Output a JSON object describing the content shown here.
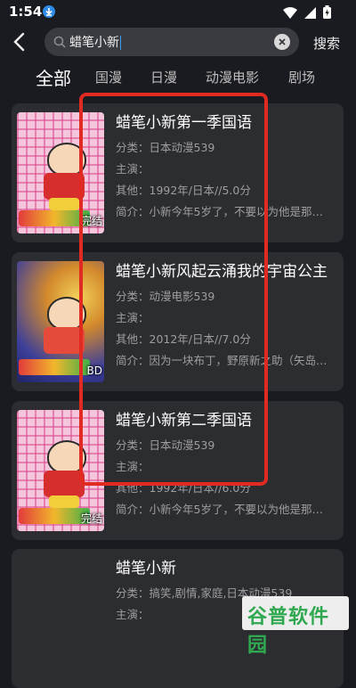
{
  "status_bar": {
    "time": "1:54"
  },
  "search": {
    "query": "蜡笔小新",
    "submit_label": "搜索"
  },
  "tabs": [
    {
      "label": "全部",
      "active": true
    },
    {
      "label": "国漫",
      "active": false
    },
    {
      "label": "日漫",
      "active": false
    },
    {
      "label": "动漫电影",
      "active": false
    },
    {
      "label": "剧场",
      "active": false
    }
  ],
  "results": [
    {
      "title": "蜡笔小新第一季国语",
      "category": "分类：日本动漫539",
      "cast": "主演：",
      "other": "其他：1992年/日本//5.0分",
      "summary": "简介：小新今年5岁了，不要以为他是那…",
      "badge": "完结"
    },
    {
      "title": "蜡笔小新风起云涌我的宇宙公主",
      "category": "分类：动漫电影539",
      "cast": "主演：",
      "other": "其他：2012年/日本//7.0分",
      "summary": "简介：因为一块布丁，野原新之助（矢岛…",
      "badge": "BD"
    },
    {
      "title": "蜡笔小新第二季国语",
      "category": "分类：日本动漫539",
      "cast": "主演：",
      "other": "其他：1992年/日本//6.0分",
      "summary": "简介：小新今年5岁了，不要以为他是那…",
      "badge": "完结"
    },
    {
      "title": "蜡笔小新",
      "category": "分类：搞笑,剧情,家庭,日本动漫539",
      "cast": "主演：",
      "other": "",
      "summary": "",
      "badge": ""
    }
  ],
  "watermark": {
    "text": "谷普软件园"
  },
  "colors": {
    "background": "#1a1b21",
    "card": "#2c2d31",
    "highlight": "#e02a22",
    "accent": "#3a9cf0"
  }
}
